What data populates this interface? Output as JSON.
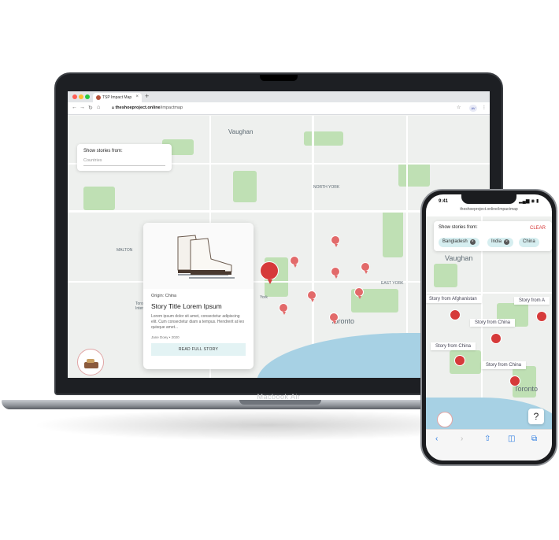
{
  "browser": {
    "tab_title": "TSP Impact Map",
    "tab_close": "×",
    "new_tab": "+",
    "url_domain": "theshoeproject.online",
    "url_path": "/impactmap",
    "profile": "AV"
  },
  "map": {
    "labels": {
      "vaughan": "Vaughan",
      "north_york": "NORTH YORK",
      "toronto": "Toronto",
      "east_york": "EAST YORK",
      "malton": "MALTON",
      "york": "York",
      "toronto_intl": "Toro Interna"
    }
  },
  "filter": {
    "title": "Show stories from:",
    "placeholder": "Countries"
  },
  "story_card": {
    "origin": "Origin: China",
    "title": "Story Title Lorem Ipsum",
    "excerpt": "Lorem ipsum dolor sit amet, consectetur adipiscing elit. Cum consectetur diam a tempus. Hendrerit at leo quisque amet...",
    "author": "Jane Doey",
    "separator": "•",
    "year": "2020",
    "button_label": "READ FULL STORY"
  },
  "laptop": {
    "brand": "Macbook Air"
  },
  "phone": {
    "time": "9:41",
    "status": "▂▄▆ ◉ ▮",
    "url": "theshoeproject.online/impactmap",
    "filter_title": "Show stories from:",
    "clear_label": "CLEAR",
    "chips": [
      "Bangladesh",
      "India",
      "China"
    ],
    "chip_remove": "×",
    "map_vaughan": "Vaughan",
    "map_toronto": "Toronto",
    "story_labels": {
      "afghanistan": "Story from Afghanistan",
      "china1": "Story from China",
      "china2": "Story from China",
      "china3": "Story from China",
      "cut": "Story from A"
    },
    "help": "?",
    "toolbar": {
      "back": "‹",
      "forward": "›",
      "share": "⇧",
      "bookmarks": "◫",
      "tabs": "⧉"
    }
  },
  "colors": {
    "pin": "#e26a6a",
    "pin_active": "#d63a3a",
    "chip": "#d6eef0",
    "button": "#e3f3f4",
    "lake": "#a7d1e4",
    "park": "#bfe0b4"
  }
}
